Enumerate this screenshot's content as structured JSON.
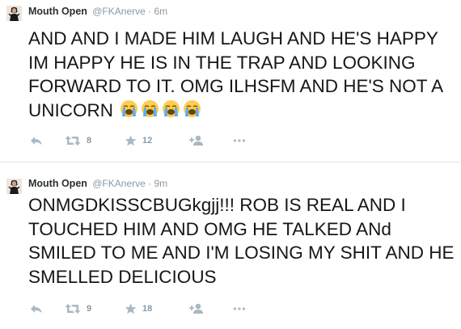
{
  "colors": {
    "text": "#14171a",
    "name": "#292f33",
    "meta": "#8899a6",
    "icon": "#aab8c2",
    "divider": "#e1e8ed"
  },
  "tweets": [
    {
      "author_name": "Mouth Open",
      "handle": "@FKAnerve",
      "separator": "·",
      "time": "6m",
      "text": "AND AND I MADE HIM LAUGH AND HE'S HAPPY IM HAPPY HE IS IN THE TRAP AND LOOKING FORWARD TO IT. OMG ILHSFM AND HE'S NOT A UNICORN",
      "emoji": [
        "loudly-crying-face-emoji",
        "loudly-crying-face-emoji",
        "loudly-crying-face-emoji",
        "loudly-crying-face-emoji"
      ],
      "retweets": "8",
      "favorites": "12"
    },
    {
      "author_name": "Mouth Open",
      "handle": "@FKAnerve",
      "separator": "·",
      "time": "9m",
      "text": "ONMGDKISSCBUGkgjj!!! ROB IS REAL AND I TOUCHED HIM AND OMG HE TALKED ANd SMILED TO ME AND I'M LOSING MY SHIT AND HE SMELLED DELICIOUS",
      "retweets": "9",
      "favorites": "18"
    }
  ],
  "icons": {
    "avatar": "avatar-photo",
    "reply": "reply-icon",
    "retweet": "retweet-icon",
    "favorite": "star-icon",
    "follow": "follow-user-icon",
    "more": "more-dots-icon"
  }
}
